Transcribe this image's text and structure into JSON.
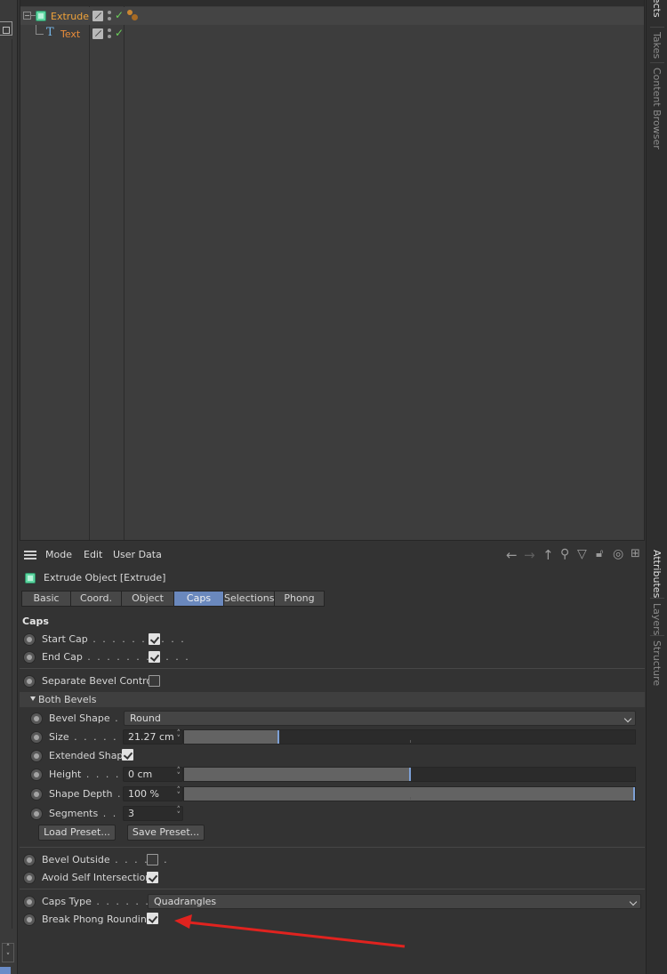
{
  "right_tabs": {
    "objects": "Objects",
    "takes": "Takes",
    "content_browser": "Content Browser",
    "attributes": "Attributes",
    "layers": "Layers",
    "structure": "Structure"
  },
  "object_manager": {
    "objects": [
      {
        "name": "Extrude",
        "type": "extrude-object",
        "color": "#f0a33a"
      },
      {
        "name": "Text",
        "type": "text-spline",
        "color": "#e98c3a"
      }
    ]
  },
  "attributes": {
    "menu": {
      "mode": "Mode",
      "edit": "Edit",
      "user_data": "User Data"
    },
    "object_title": "Extrude Object [Extrude]",
    "tabs": [
      "Basic",
      "Coord.",
      "Object",
      "Caps",
      "Selections",
      "Phong"
    ],
    "active_tab": "Caps",
    "section_title": "Caps",
    "start_cap": {
      "label": "Start Cap",
      "dots": " . . . . . . . . . .",
      "checked": true
    },
    "end_cap": {
      "label": "End Cap",
      "dots": " . . . . . . . . . . .",
      "checked": true
    },
    "separate_bevel": {
      "label": "Separate Bevel Controls",
      "checked": false
    },
    "both_bevels": {
      "label": "Both Bevels",
      "bevel_shape": {
        "label": "Bevel Shape",
        "dots": " . . .",
        "value": "Round"
      },
      "size": {
        "label": "Size",
        "dots": " . . . . . . . .",
        "value": "21.27 cm",
        "level": 0.21
      },
      "extended_shape": {
        "label": "Extended Shape",
        "checked": true
      },
      "height": {
        "label": "Height",
        "dots": " . . . . . .",
        "value": "0 cm",
        "level": 0.5
      },
      "shape_depth": {
        "label": "Shape Depth",
        "dots": " . .",
        "value": "100 %",
        "level": 1.0
      },
      "segments": {
        "label": "Segments",
        "dots": " . . . .",
        "value": "3"
      },
      "load_preset": "Load Preset...",
      "save_preset": "Save Preset..."
    },
    "bevel_outside": {
      "label": "Bevel Outside",
      "dots": " . . . . . .",
      "checked": false
    },
    "avoid_self_intersections": {
      "label": "Avoid Self Intersections",
      "checked": true
    },
    "caps_type": {
      "label": "Caps Type",
      "dots": " . . . . . . . . . .",
      "value": "Quadrangles"
    },
    "break_phong_rounding": {
      "label": "Break Phong Rounding",
      "checked": true
    }
  },
  "colors": {
    "accent_tab": "#6a88bd",
    "annotation_arrow": "#e0231f",
    "check_green": "#6ccf5a"
  }
}
